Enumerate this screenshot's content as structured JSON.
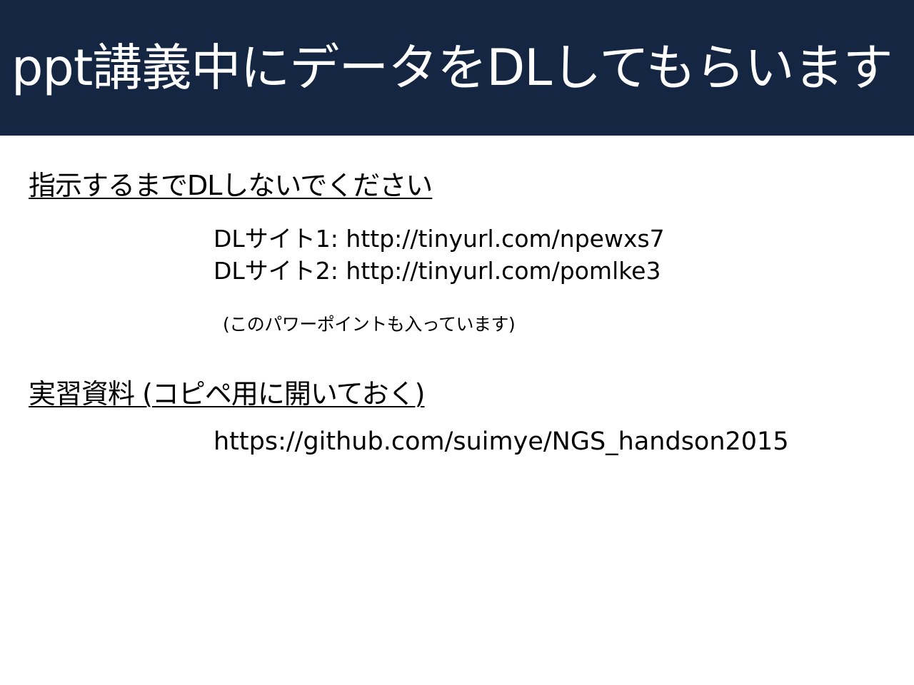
{
  "slide": {
    "title": "ppt講義中にデータをDLしてもらいます",
    "colors": {
      "title_bar": "#142642",
      "title_text": "#ffffff",
      "body_text": "#000000",
      "background": "#ffffff"
    }
  },
  "section1": {
    "heading": "指示するまでDLしないでください",
    "links": [
      "DLサイト1: http://tinyurl.com/npewxs7",
      "DLサイト2: http://tinyurl.com/pomlke3"
    ],
    "note": "(このパワーポイントも入っています)"
  },
  "section2": {
    "heading": "実習資料 (コピペ用に開いておく)",
    "url": "https://github.com/suimye/NGS_handson2015"
  }
}
